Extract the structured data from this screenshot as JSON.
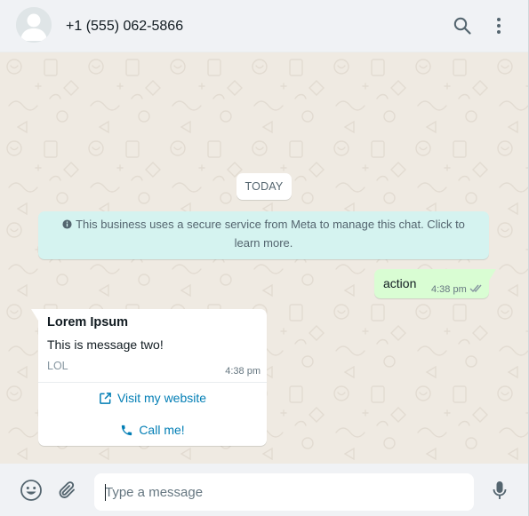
{
  "header": {
    "contact_name": "+1 (555) 062-5866",
    "icons": [
      "default-avatar-icon",
      "search-icon",
      "more-vertical-icon"
    ]
  },
  "chat": {
    "date_chip": "TODAY",
    "system_notice": {
      "icon": "info-icon",
      "text": "This business uses a secure service from Meta to manage this chat. Click to learn more."
    },
    "messages": [
      {
        "direction": "outgoing",
        "text": "action",
        "time": "4:38 pm",
        "status_icon": "double-check-icon"
      },
      {
        "direction": "incoming",
        "title": "Lorem Ipsum",
        "body": "This is message two!",
        "footer": "LOL",
        "time": "4:38 pm",
        "buttons": [
          {
            "icon": "external-link-icon",
            "label": "Visit my website"
          },
          {
            "icon": "phone-icon",
            "label": "Call me!"
          }
        ]
      }
    ]
  },
  "composer": {
    "placeholder": "Type a message",
    "value": "",
    "icons": [
      "emoji-icon",
      "attach-icon",
      "microphone-icon"
    ]
  },
  "colors": {
    "header_bg": "#f0f2f5",
    "chat_bg": "#efeae2",
    "outgoing_bubble": "#d9fdd3",
    "incoming_bubble": "#ffffff",
    "system_notice_bg": "#d5f3f0",
    "link_blue": "#027eb5",
    "read_tick": "#8696a0"
  }
}
